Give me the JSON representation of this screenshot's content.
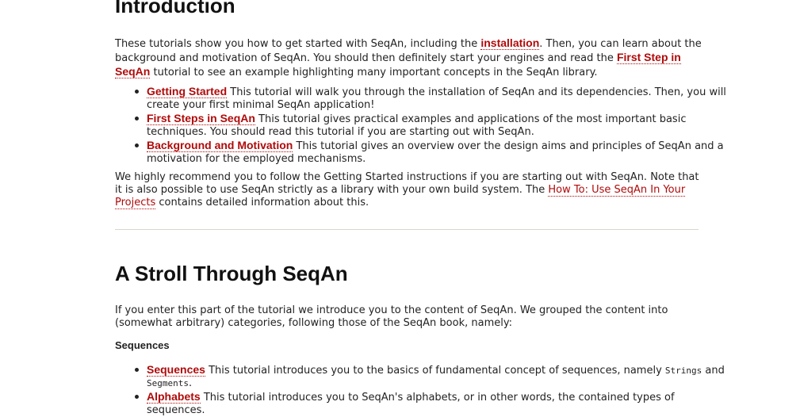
{
  "intro": {
    "title": "Introduction",
    "p1": {
      "t1": "These tutorials show you how to get started with SeqAn, including the ",
      "link1": "installation",
      "t2": ". Then, you can learn about the background and motivation of SeqAn. You should then definitely start your engines and read the ",
      "link2": "First Step in SeqAn",
      "t3": " tutorial to see an example highlighting many important concepts in the SeqAn library."
    },
    "items": [
      {
        "link": "Getting Started",
        "text": " This tutorial will walk you through the installation of SeqAn and its dependencies. Then, you will create your first minimal SeqAn application!"
      },
      {
        "link": "First Steps in SeqAn",
        "text": " This tutorial gives practical examples and applications of the most important basic techniques. You should read this tutorial if you are starting out with SeqAn."
      },
      {
        "link": "Background and Motivation",
        "text": " This tutorial gives an overview over the design aims and principles of SeqAn and a motivation for the employed mechanisms."
      }
    ],
    "p2": {
      "t1": "We highly recommend you to follow the Getting Started instructions if you are starting out with SeqAn. Note that it is also possible to use SeqAn strictly as a library with your own build system. The ",
      "link": "How To: Use SeqAn In Your Projects",
      "t2": " contains detailed information about this."
    }
  },
  "stroll": {
    "title": "A Stroll Through SeqAn",
    "p": "If you enter this part of the tutorial we introduce you to the content of SeqAn. We grouped the content into (somewhat arbitrary) categories, following those of the SeqAn book, namely:",
    "subhead": "Sequences",
    "items": [
      {
        "link": "Sequences",
        "t1": " This tutorial introduces you to the basics of fundamental concept of sequences, namely ",
        "code1": "Strings",
        "t2": " and ",
        "code2": "Segments",
        "t3": "."
      },
      {
        "link": "Alphabets",
        "t1": " This tutorial introduces you to SeqAn's alphabets, or in other words, the contained types of sequences."
      }
    ]
  }
}
